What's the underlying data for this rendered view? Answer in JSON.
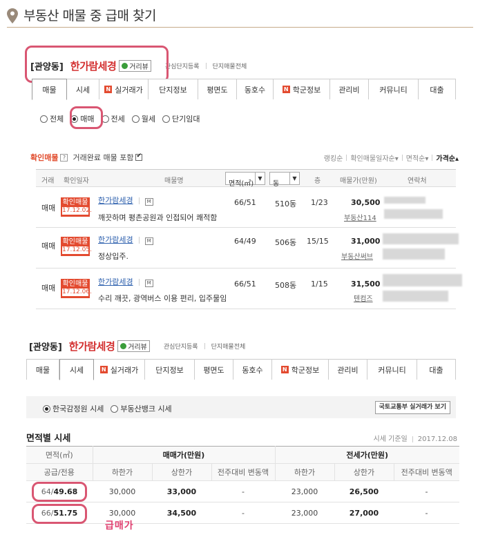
{
  "page": {
    "title": "부동산 매물 중 급매 찾기"
  },
  "complex": {
    "region": "[관양동]",
    "name": "한가람세경",
    "road_view": "거리뷰",
    "links": [
      "관심단지등록",
      "단지매물전체"
    ]
  },
  "tabs": [
    {
      "label": "매물",
      "badge": ""
    },
    {
      "label": "시세",
      "badge": ""
    },
    {
      "label": "실거래가",
      "badge": "N"
    },
    {
      "label": "단지정보",
      "badge": ""
    },
    {
      "label": "평면도",
      "badge": ""
    },
    {
      "label": "동호수",
      "badge": ""
    },
    {
      "label": "학군정보",
      "badge": "N"
    },
    {
      "label": "관리비",
      "badge": ""
    },
    {
      "label": "커뮤니티",
      "badge": ""
    },
    {
      "label": "대출",
      "badge": ""
    }
  ],
  "deal_types": [
    "전체",
    "매매",
    "전세",
    "월세",
    "단기임대"
  ],
  "listing": {
    "confirm_label": "확인매물",
    "help": "?",
    "include_done": "거래완료 매물 포함",
    "sorts": [
      "랭킹순",
      "확인매물일자순▾",
      "면적순▾",
      "가격순▴"
    ],
    "headers": {
      "deal": "거래",
      "date": "확인일자",
      "name": "매물명",
      "area": "면적(㎡)",
      "dong": "동",
      "floor": "층",
      "price": "매물가(만원)",
      "contact": "연락처"
    },
    "badge_label": "확인매물",
    "m_icon": "M",
    "rows": [
      {
        "deal": "매매",
        "date": "17.12.02.",
        "name": "한가람세경",
        "area": "66/51",
        "dong": "510동",
        "floor": "1/23",
        "price": "30,500",
        "agent": "부동산114",
        "desc": "깨끗하며 평촌공원과 인접되어 쾌적함"
      },
      {
        "deal": "매매",
        "date": "17.12.05.",
        "name": "한가람세경",
        "area": "64/49",
        "dong": "506동",
        "floor": "15/15",
        "price": "31,000",
        "agent": "부동산써브",
        "desc": "정상입주."
      },
      {
        "deal": "매매",
        "date": "17.12.06.",
        "name": "한가람세경",
        "area": "66/51",
        "dong": "508동",
        "floor": "1/15",
        "price": "31,500",
        "agent": "텐컴즈",
        "desc": "수리 깨끗, 광역버스 이용 편리, 입주물임"
      }
    ]
  },
  "price_section": {
    "sources": [
      "한국감정원 시세",
      "부동산뱅크 시세"
    ],
    "real_trade_button": "국토교통부 실거래가 보기",
    "title": "면적별 시세",
    "date_label": "시세 기준일",
    "date_value": "2017.12.08",
    "head_area": "면적(㎡)",
    "head_sale": "매매가(만원)",
    "head_jeonse": "전세가(만원)",
    "sub_heads": {
      "area": "공급/전용",
      "low": "하한가",
      "high": "상한가",
      "change": "전주대비 변동액"
    },
    "rows": [
      {
        "supply": "64/",
        "exclusive": "49.68",
        "sale_low": "30,000",
        "sale_high": "33,000",
        "sale_change": "-",
        "jeonse_low": "23,000",
        "jeonse_high": "26,500",
        "jeonse_change": "-"
      },
      {
        "supply": "66/",
        "exclusive": "51.75",
        "sale_low": "30,000",
        "sale_high": "34,500",
        "sale_change": "-",
        "jeonse_low": "23,000",
        "jeonse_high": "27,000",
        "jeonse_change": "-"
      }
    ],
    "annotation": "급매가"
  },
  "colors": {
    "accent": "#d95672",
    "red": "#e34a2f",
    "link": "#2c5fad"
  }
}
